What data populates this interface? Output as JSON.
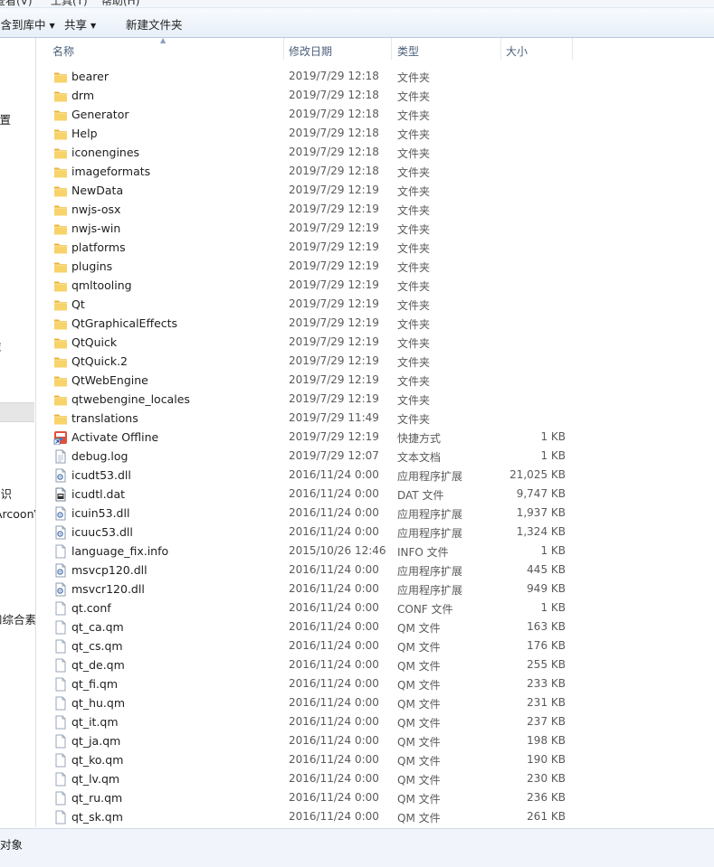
{
  "menu": [
    "查看(V)",
    "工具(T)",
    "帮助(H)"
  ],
  "toolbar": {
    "include_in_library": "包含到库中",
    "share": "共享",
    "new_folder": "新建文件夹"
  },
  "nav_fragments": [
    "位置",
    "库",
    "知识",
    "ArcoonV",
    "和综合素"
  ],
  "columns": {
    "name": "名称",
    "date": "修改日期",
    "type": "类型",
    "size": "大小"
  },
  "files": [
    {
      "name": "bearer",
      "date": "2019/7/29 12:18",
      "type": "文件夹",
      "size": "",
      "icon": "folder-icon"
    },
    {
      "name": "drm",
      "date": "2019/7/29 12:18",
      "type": "文件夹",
      "size": "",
      "icon": "folder-icon"
    },
    {
      "name": "Generator",
      "date": "2019/7/29 12:18",
      "type": "文件夹",
      "size": "",
      "icon": "folder-icon"
    },
    {
      "name": "Help",
      "date": "2019/7/29 12:18",
      "type": "文件夹",
      "size": "",
      "icon": "folder-icon"
    },
    {
      "name": "iconengines",
      "date": "2019/7/29 12:18",
      "type": "文件夹",
      "size": "",
      "icon": "folder-icon"
    },
    {
      "name": "imageformats",
      "date": "2019/7/29 12:18",
      "type": "文件夹",
      "size": "",
      "icon": "folder-icon"
    },
    {
      "name": "NewData",
      "date": "2019/7/29 12:19",
      "type": "文件夹",
      "size": "",
      "icon": "folder-icon"
    },
    {
      "name": "nwjs-osx",
      "date": "2019/7/29 12:19",
      "type": "文件夹",
      "size": "",
      "icon": "folder-icon"
    },
    {
      "name": "nwjs-win",
      "date": "2019/7/29 12:19",
      "type": "文件夹",
      "size": "",
      "icon": "folder-icon"
    },
    {
      "name": "platforms",
      "date": "2019/7/29 12:19",
      "type": "文件夹",
      "size": "",
      "icon": "folder-icon"
    },
    {
      "name": "plugins",
      "date": "2019/7/29 12:19",
      "type": "文件夹",
      "size": "",
      "icon": "folder-icon"
    },
    {
      "name": "qmltooling",
      "date": "2019/7/29 12:19",
      "type": "文件夹",
      "size": "",
      "icon": "folder-icon"
    },
    {
      "name": "Qt",
      "date": "2019/7/29 12:19",
      "type": "文件夹",
      "size": "",
      "icon": "folder-icon"
    },
    {
      "name": "QtGraphicalEffects",
      "date": "2019/7/29 12:19",
      "type": "文件夹",
      "size": "",
      "icon": "folder-icon"
    },
    {
      "name": "QtQuick",
      "date": "2019/7/29 12:19",
      "type": "文件夹",
      "size": "",
      "icon": "folder-icon"
    },
    {
      "name": "QtQuick.2",
      "date": "2019/7/29 12:19",
      "type": "文件夹",
      "size": "",
      "icon": "folder-icon"
    },
    {
      "name": "QtWebEngine",
      "date": "2019/7/29 12:19",
      "type": "文件夹",
      "size": "",
      "icon": "folder-icon"
    },
    {
      "name": "qtwebengine_locales",
      "date": "2019/7/29 12:19",
      "type": "文件夹",
      "size": "",
      "icon": "folder-icon"
    },
    {
      "name": "translations",
      "date": "2019/7/29 11:49",
      "type": "文件夹",
      "size": "",
      "icon": "folder-icon"
    },
    {
      "name": "Activate Offline",
      "date": "2019/7/29 12:19",
      "type": "快捷方式",
      "size": "1 KB",
      "icon": "shortcut-icon"
    },
    {
      "name": "debug.log",
      "date": "2019/7/29 12:07",
      "type": "文本文档",
      "size": "1 KB",
      "icon": "text-document-icon"
    },
    {
      "name": "icudt53.dll",
      "date": "2016/11/24 0:00",
      "type": "应用程序扩展",
      "size": "21,025 KB",
      "icon": "dll-icon"
    },
    {
      "name": "icudtl.dat",
      "date": "2016/11/24 0:00",
      "type": "DAT 文件",
      "size": "9,747 KB",
      "icon": "dat-file-icon"
    },
    {
      "name": "icuin53.dll",
      "date": "2016/11/24 0:00",
      "type": "应用程序扩展",
      "size": "1,937 KB",
      "icon": "dll-icon"
    },
    {
      "name": "icuuc53.dll",
      "date": "2016/11/24 0:00",
      "type": "应用程序扩展",
      "size": "1,324 KB",
      "icon": "dll-icon"
    },
    {
      "name": "language_fix.info",
      "date": "2015/10/26 12:46",
      "type": "INFO 文件",
      "size": "1 KB",
      "icon": "generic-file-icon"
    },
    {
      "name": "msvcp120.dll",
      "date": "2016/11/24 0:00",
      "type": "应用程序扩展",
      "size": "445 KB",
      "icon": "dll-icon"
    },
    {
      "name": "msvcr120.dll",
      "date": "2016/11/24 0:00",
      "type": "应用程序扩展",
      "size": "949 KB",
      "icon": "dll-icon"
    },
    {
      "name": "qt.conf",
      "date": "2016/11/24 0:00",
      "type": "CONF 文件",
      "size": "1 KB",
      "icon": "generic-file-icon"
    },
    {
      "name": "qt_ca.qm",
      "date": "2016/11/24 0:00",
      "type": "QM 文件",
      "size": "163 KB",
      "icon": "generic-file-icon"
    },
    {
      "name": "qt_cs.qm",
      "date": "2016/11/24 0:00",
      "type": "QM 文件",
      "size": "176 KB",
      "icon": "generic-file-icon"
    },
    {
      "name": "qt_de.qm",
      "date": "2016/11/24 0:00",
      "type": "QM 文件",
      "size": "255 KB",
      "icon": "generic-file-icon"
    },
    {
      "name": "qt_fi.qm",
      "date": "2016/11/24 0:00",
      "type": "QM 文件",
      "size": "233 KB",
      "icon": "generic-file-icon"
    },
    {
      "name": "qt_hu.qm",
      "date": "2016/11/24 0:00",
      "type": "QM 文件",
      "size": "231 KB",
      "icon": "generic-file-icon"
    },
    {
      "name": "qt_it.qm",
      "date": "2016/11/24 0:00",
      "type": "QM 文件",
      "size": "237 KB",
      "icon": "generic-file-icon"
    },
    {
      "name": "qt_ja.qm",
      "date": "2016/11/24 0:00",
      "type": "QM 文件",
      "size": "198 KB",
      "icon": "generic-file-icon"
    },
    {
      "name": "qt_ko.qm",
      "date": "2016/11/24 0:00",
      "type": "QM 文件",
      "size": "190 KB",
      "icon": "generic-file-icon"
    },
    {
      "name": "qt_lv.qm",
      "date": "2016/11/24 0:00",
      "type": "QM 文件",
      "size": "230 KB",
      "icon": "generic-file-icon"
    },
    {
      "name": "qt_ru.qm",
      "date": "2016/11/24 0:00",
      "type": "QM 文件",
      "size": "236 KB",
      "icon": "generic-file-icon"
    },
    {
      "name": "qt_sk.qm",
      "date": "2016/11/24 0:00",
      "type": "QM 文件",
      "size": "261 KB",
      "icon": "generic-file-icon"
    }
  ],
  "status": {
    "text": "对象"
  }
}
